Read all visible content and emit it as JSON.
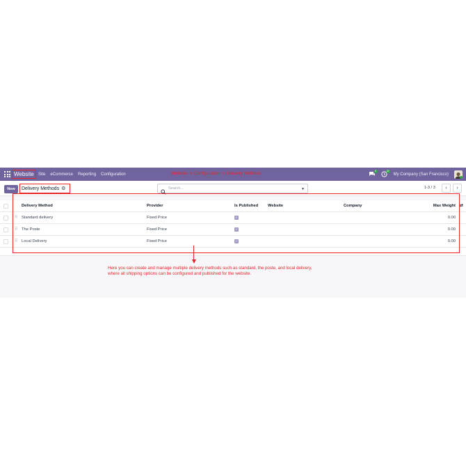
{
  "navbar": {
    "brand": "Website",
    "menu": [
      "Site",
      "eCommerce",
      "Reporting",
      "Configuration"
    ],
    "annotation": "Website -> Configuration -> Delivery Methods",
    "chat_badge": "8",
    "activity_badge": "20",
    "company": "My Company (San Francisco)"
  },
  "control": {
    "new_label": "New",
    "breadcrumb": "Delivery Methods",
    "search_placeholder": "Search...",
    "pager": "1-3 / 3"
  },
  "list": {
    "columns": {
      "method": "Delivery Method",
      "provider": "Provider",
      "published": "Is Published",
      "website": "Website",
      "company": "Company",
      "max_weight": "Max Weight"
    },
    "rows": [
      {
        "method": "Standard delivery",
        "provider": "Fixed Price",
        "published": true,
        "website": "",
        "company": "",
        "max_weight": "0.00"
      },
      {
        "method": "The Poste",
        "provider": "Fixed Price",
        "published": true,
        "website": "",
        "company": "",
        "max_weight": "0.00"
      },
      {
        "method": "Local Delivery",
        "provider": "Fixed Price",
        "published": true,
        "website": "",
        "company": "",
        "max_weight": "0.00"
      }
    ]
  },
  "annotation": {
    "text_line1": "Here you can create and manage multiple delivery methods such as standard, the poste, and local delivery,",
    "text_line2": "where all shipping options can be configured and published for the website."
  },
  "colors": {
    "brand_purple": "#71639e",
    "annotation_red": "#e8262a",
    "badge_green": "#28a745"
  }
}
